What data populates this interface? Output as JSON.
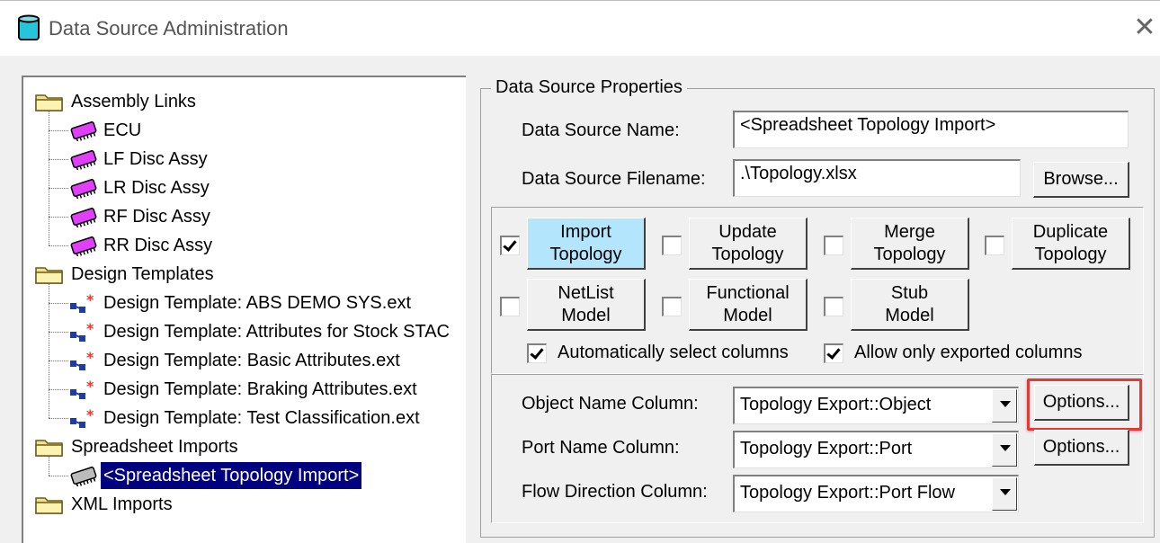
{
  "window": {
    "title": "Data Source Administration",
    "close": "✕"
  },
  "tree": {
    "groups": [
      {
        "label": "Assembly Links",
        "children": [
          "ECU",
          "LF Disc Assy",
          "LR Disc Assy",
          "RF Disc Assy",
          "RR Disc Assy"
        ]
      },
      {
        "label": "Design Templates",
        "children": [
          "Design Template: ABS DEMO SYS.ext",
          "Design Template: Attributes for Stock STAC",
          "Design Template: Basic Attributes.ext",
          "Design Template: Braking Attributes.ext",
          "Design Template: Test Classification.ext"
        ]
      },
      {
        "label": "Spreadsheet Imports",
        "children": [
          "<Spreadsheet Topology Import>"
        ]
      },
      {
        "label": "XML Imports",
        "children": []
      }
    ],
    "selected": "<Spreadsheet Topology Import>"
  },
  "properties": {
    "legend": "Data Source Properties",
    "name_label": "Data Source Name:",
    "name_value": "<Spreadsheet Topology Import>",
    "filename_label": "Data Source Filename:",
    "filename_value": ".\\Topology.xlsx",
    "browse_label": "Browse..."
  },
  "import_options": [
    {
      "label": "Import\nTopology",
      "checked": true,
      "active": true
    },
    {
      "label": "Update\nTopology",
      "checked": false,
      "active": false
    },
    {
      "label": "Merge\nTopology",
      "checked": false,
      "active": false
    },
    {
      "label": "Duplicate\nTopology",
      "checked": false,
      "active": false
    },
    {
      "label": "NetList\nModel",
      "checked": false,
      "active": false
    },
    {
      "label": "Functional\nModel",
      "checked": false,
      "active": false
    },
    {
      "label": "Stub\nModel",
      "checked": false,
      "active": false
    }
  ],
  "auto_select": {
    "label": "Automatically select columns",
    "checked": true
  },
  "exported_only": {
    "label": "Allow only exported columns",
    "checked": true
  },
  "columns": {
    "object_label": "Object Name Column:",
    "object_value": "Topology Export::Object",
    "port_label": "Port Name Column:",
    "port_value": "Topology Export::Port",
    "flow_label": "Flow Direction Column:",
    "flow_value": "Topology Export::Port Flow",
    "options_label": "Options...",
    "highlight_color": "#e53935"
  },
  "colors": {
    "selection": "#000080",
    "active_option": "#b3e5fc",
    "chip": "#e040fb"
  }
}
